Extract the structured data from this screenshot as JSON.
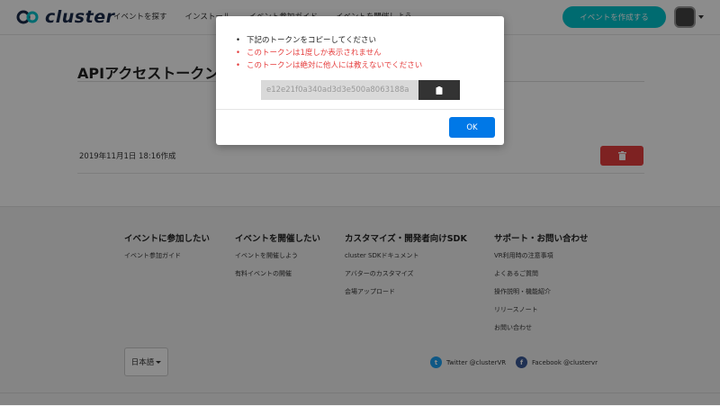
{
  "header": {
    "logo_text": "cluster",
    "nav": [
      {
        "label": "イベントを探す"
      },
      {
        "label": "インストール"
      },
      {
        "label": "イベント参加ガイド"
      },
      {
        "label": "イベントを開催しよう"
      }
    ],
    "create_event_label": "イベントを作成する",
    "accent_color": "#00c3cc"
  },
  "main": {
    "title": "APIアクセストークン",
    "tokens": [
      {
        "created": "2019年11月1日 18:16作成"
      }
    ],
    "delete_color": "#e53e3e"
  },
  "footer": {
    "columns": [
      {
        "heading": "イベントに参加したい",
        "links": [
          "イベント参加ガイド"
        ]
      },
      {
        "heading": "イベントを開催したい",
        "links": [
          "イベントを開催しよう",
          "有料イベントの開催"
        ]
      },
      {
        "heading": "カスタマイズ・開発者向けSDK",
        "links": [
          "cluster SDKドキュメント",
          "アバターのカスタマイズ",
          "会場アップロード"
        ]
      },
      {
        "heading": "サポート・お問い合わせ",
        "links": [
          "VR利用時の注意事項",
          "よくあるご質問",
          "操作説明・機能紹介",
          "リリースノート",
          "お問い合わせ"
        ]
      }
    ],
    "language": "日本語",
    "twitter": "Twitter @clusterVR",
    "facebook": "Facebook @clustervr"
  },
  "modal": {
    "messages": [
      {
        "text": "下記のトークンをコピーしてください",
        "type": "plain"
      },
      {
        "text": "このトークンは1度しか表示されません",
        "type": "warn"
      },
      {
        "text": "このトークンは絶対に他人には教えないでください",
        "type": "warn"
      }
    ],
    "token_value": "e12e21f0a340ad3d3e500a8063188a",
    "ok_label": "OK",
    "ok_color": "#0078e7"
  }
}
